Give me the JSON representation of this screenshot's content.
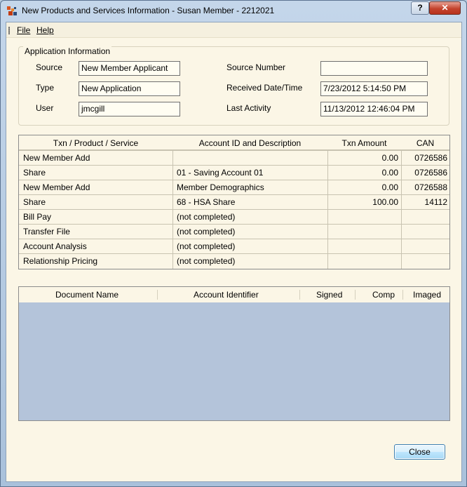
{
  "window": {
    "title": "New Products and Services Information - Susan Member - 2212021",
    "help_button": "?",
    "close_button": "✕"
  },
  "menu": {
    "file": "File",
    "help": "Help"
  },
  "application_info": {
    "legend": "Application Information",
    "source_label": "Source",
    "source_value": "New Member Applicant",
    "type_label": "Type",
    "type_value": "New Application",
    "user_label": "User",
    "user_value": "jmcgill",
    "source_number_label": "Source Number",
    "source_number_value": "",
    "received_label": "Received Date/Time",
    "received_value": "7/23/2012 5:14:50 PM",
    "last_activity_label": "Last Activity",
    "last_activity_value": "11/13/2012 12:46:04 PM"
  },
  "txn_table": {
    "columns": [
      "Txn / Product / Service",
      "Account ID and Description",
      "Txn Amount",
      "CAN"
    ],
    "rows": [
      [
        "New Member Add",
        "",
        "0.00",
        "0726586"
      ],
      [
        "Share",
        "01 - Saving Account 01",
        "0.00",
        "0726586"
      ],
      [
        "New Member Add",
        "Member Demographics",
        "0.00",
        "0726588"
      ],
      [
        "Share",
        "68 - HSA Share",
        "100.00",
        "14112"
      ],
      [
        "Bill Pay",
        "(not completed)",
        "",
        ""
      ],
      [
        "Transfer File",
        "(not completed)",
        "",
        ""
      ],
      [
        "Account Analysis",
        "(not completed)",
        "",
        ""
      ],
      [
        "Relationship Pricing",
        "(not completed)",
        "",
        ""
      ]
    ]
  },
  "doc_table": {
    "columns": [
      "Document Name",
      "Account Identifier",
      "Signed",
      "Comp",
      "Imaged"
    ]
  },
  "buttons": {
    "close": "Close"
  }
}
